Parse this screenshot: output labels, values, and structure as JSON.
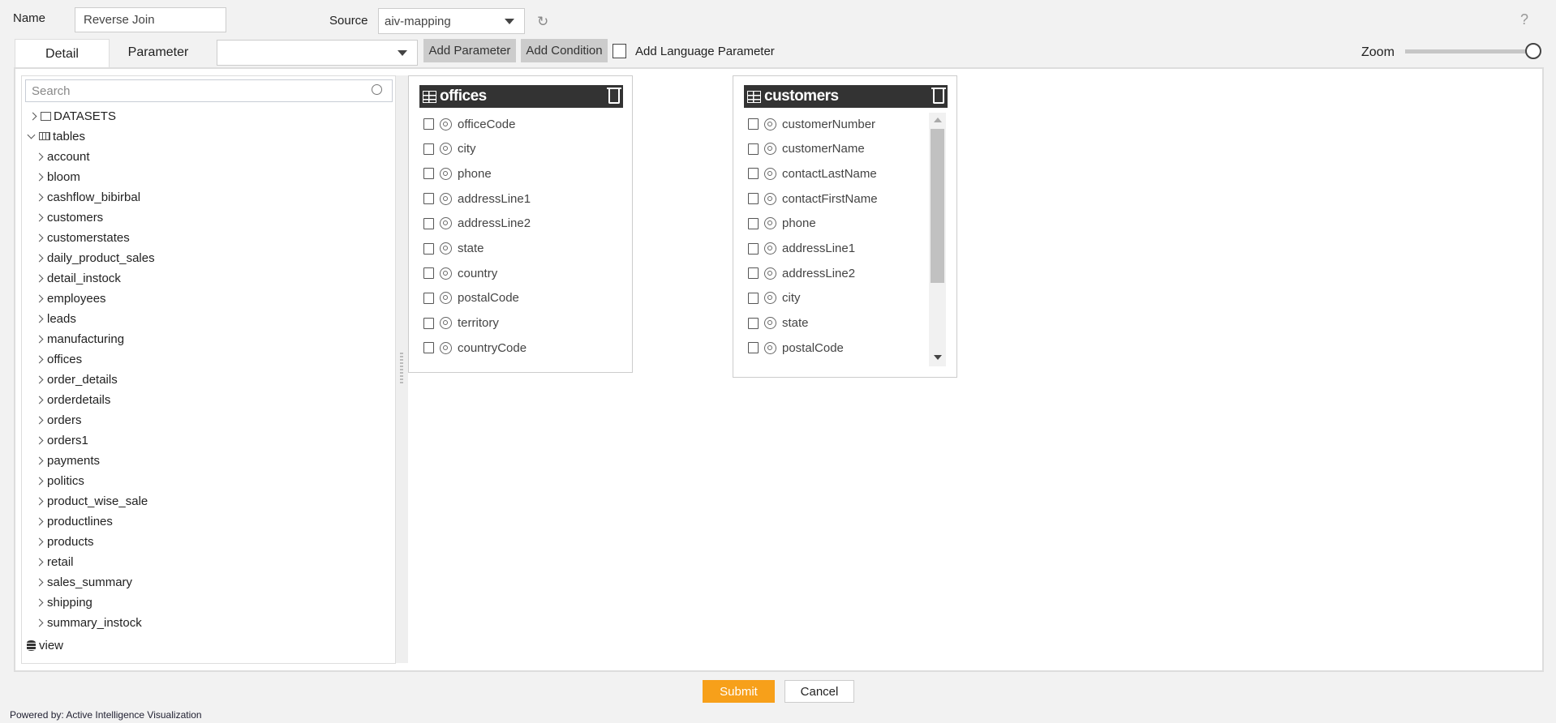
{
  "header": {
    "name_label": "Name",
    "name_value": "Reverse Join",
    "source_label": "Source",
    "source_value": "aiv-mapping",
    "help": "?"
  },
  "tabs": [
    {
      "label": "Detail",
      "active": true
    },
    {
      "label": "Parameter",
      "active": false
    }
  ],
  "toolbar": {
    "parameter_select_value": "",
    "add_parameter": "Add Parameter",
    "add_condition": "Add Condition",
    "add_language_parameter": "Add Language Parameter",
    "add_language_checked": false,
    "zoom_label": "Zoom",
    "zoom_level": 1.0
  },
  "tree": {
    "search_placeholder": "Search",
    "datasets": "DATASETS",
    "tables_label": "tables",
    "tables": [
      "account",
      "bloom",
      "cashflow_bibirbal",
      "customers",
      "customerstates",
      "daily_product_sales",
      "detail_instock",
      "employees",
      "leads",
      "manufacturing",
      "offices",
      "order_details",
      "orderdetails",
      "orders",
      "orders1",
      "payments",
      "politics",
      "product_wise_sale",
      "productlines",
      "products",
      "retail",
      "sales_summary",
      "shipping",
      "summary_instock"
    ],
    "view": "view"
  },
  "canvas": {
    "offices": {
      "title": "offices",
      "fields": [
        "officeCode",
        "city",
        "phone",
        "addressLine1",
        "addressLine2",
        "state",
        "country",
        "postalCode",
        "territory",
        "countryCode"
      ]
    },
    "customers": {
      "title": "customers",
      "fields": [
        "customerNumber",
        "customerName",
        "contactLastName",
        "contactFirstName",
        "phone",
        "addressLine1",
        "addressLine2",
        "city",
        "state",
        "postalCode"
      ]
    }
  },
  "actions": {
    "submit": "Submit",
    "cancel": "Cancel"
  },
  "footer": {
    "powered_by": "Powered by: Active Intelligence Visualization"
  },
  "colors": {
    "submit": "#f7a01a",
    "box_header": "#333333",
    "background": "#f2f2f2"
  }
}
